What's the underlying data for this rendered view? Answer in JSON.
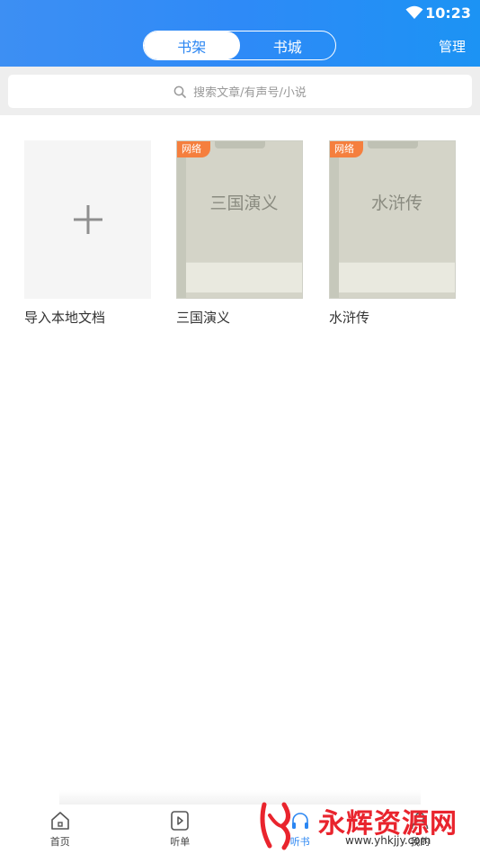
{
  "status": {
    "time": "10:23",
    "wifi_icon": "wifi-icon"
  },
  "header": {
    "tabs": [
      {
        "label": "书架",
        "active": true
      },
      {
        "label": "书城",
        "active": false
      }
    ],
    "manage_label": "管理",
    "accent": "#2b86f2"
  },
  "search": {
    "placeholder": "搜索文章/有声号/小说",
    "icon": "search-icon"
  },
  "shelf": {
    "import_label": "导入本地文档",
    "books": [
      {
        "title": "三国演义",
        "cover_text": "三国演义",
        "badge": "网络"
      },
      {
        "title": "水浒传",
        "cover_text": "水浒传",
        "badge": "网络"
      }
    ],
    "badge_color": "#f57f3e"
  },
  "tabbar": {
    "items": [
      {
        "label": "首页",
        "icon": "home-icon"
      },
      {
        "label": "听单",
        "icon": "play-icon"
      },
      {
        "label": "听书",
        "icon": "headphones-icon",
        "active": true
      },
      {
        "label": "我的",
        "icon": "user-icon"
      }
    ]
  },
  "watermark": {
    "brand": "永辉资源网",
    "url": "www.yhkjjy.com",
    "color": "#e9242d"
  }
}
